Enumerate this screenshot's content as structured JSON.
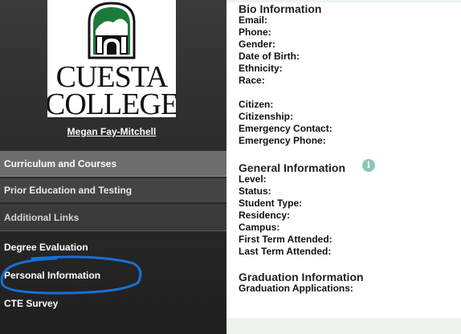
{
  "sidebar": {
    "logo_text": [
      "CUESTA",
      "COLLEGE"
    ],
    "user_name": "Megan Fay-Mitchell",
    "nav": {
      "curriculum": "Curriculum and Courses",
      "prior": "Prior Education and Testing",
      "additional": "Additional Links",
      "degree": "Degree Evaluation",
      "personal": "Personal Information",
      "cte": "CTE Survey"
    }
  },
  "main": {
    "bio": {
      "title": "Bio Information",
      "fields": [
        "Email:",
        "Phone:",
        "Gender:",
        "Date of Birth:",
        "Ethnicity:",
        "Race:"
      ],
      "fields2": [
        "Citizen:",
        "Citizenship:",
        "Emergency Contact:",
        "Emergency Phone:"
      ]
    },
    "general": {
      "title": "General Information",
      "info_icon": "i",
      "fields": [
        "Level:",
        "Status:",
        "Student Type:",
        "Residency:",
        "Campus:",
        "First Term Attended:",
        "Last Term Attended:"
      ]
    },
    "graduation": {
      "title": "Graduation Information",
      "fields": [
        "Graduation Applications:"
      ]
    }
  },
  "colors": {
    "sidebar_bg": "#2c2c2c",
    "active_nav_bg": "#6e6e6e",
    "logo_green": "#1e7a3a",
    "annotation_blue": "#1a6fd6",
    "info_icon": "#8fc4b8"
  }
}
